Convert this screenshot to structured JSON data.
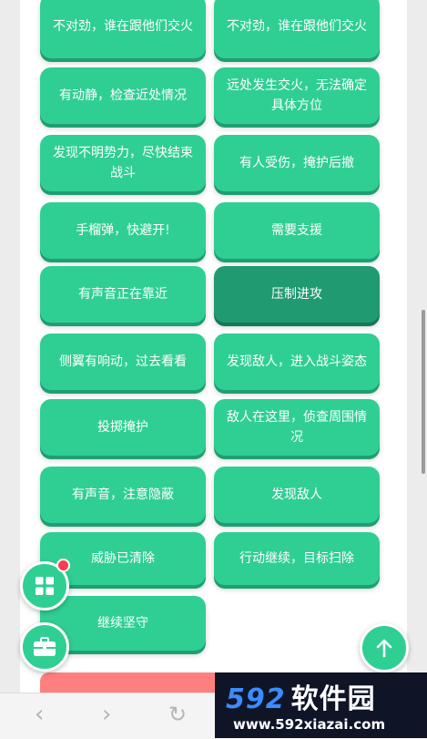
{
  "buttons": [
    {
      "label": "不对劲，谁在跟他们交火"
    },
    {
      "label": "不对劲，谁在跟他们交火"
    },
    {
      "label": "有动静，检查近处情况"
    },
    {
      "label": "远处发生交火，无法确定具体方位"
    },
    {
      "label": "发现不明势力，尽快结束战斗"
    },
    {
      "label": "有人受伤，掩护后撤"
    },
    {
      "label": "手榴弹，快避开!"
    },
    {
      "label": "需要支援"
    },
    {
      "label": "有声音正在靠近"
    },
    {
      "label": "压制进攻",
      "active": true
    },
    {
      "label": "侧翼有响动，过去看看"
    },
    {
      "label": "发现敌人，进入战斗姿态"
    },
    {
      "label": "投掷掩护"
    },
    {
      "label": "敌人在这里，侦查周围情况"
    },
    {
      "label": "有声音，注意隐蔽"
    },
    {
      "label": "发现敌人"
    },
    {
      "label": "威胁已清除"
    },
    {
      "label": "行动继续，目标扫除"
    },
    {
      "label": "继续坚守"
    }
  ],
  "fabs": {
    "menu_icon": "grid-icon",
    "toolbox_icon": "toolbox-icon",
    "top_icon": "arrow-up-icon"
  },
  "browser_nav": {
    "back": "‹",
    "forward": "›",
    "refresh": "↻"
  },
  "watermark": {
    "brand_num": "592",
    "brand_cn": "软件园",
    "url": "www.592xiazai.com"
  },
  "colors": {
    "button": "#2fcf94",
    "button_active": "#1f9a71",
    "badge": "#ff3b4f"
  }
}
